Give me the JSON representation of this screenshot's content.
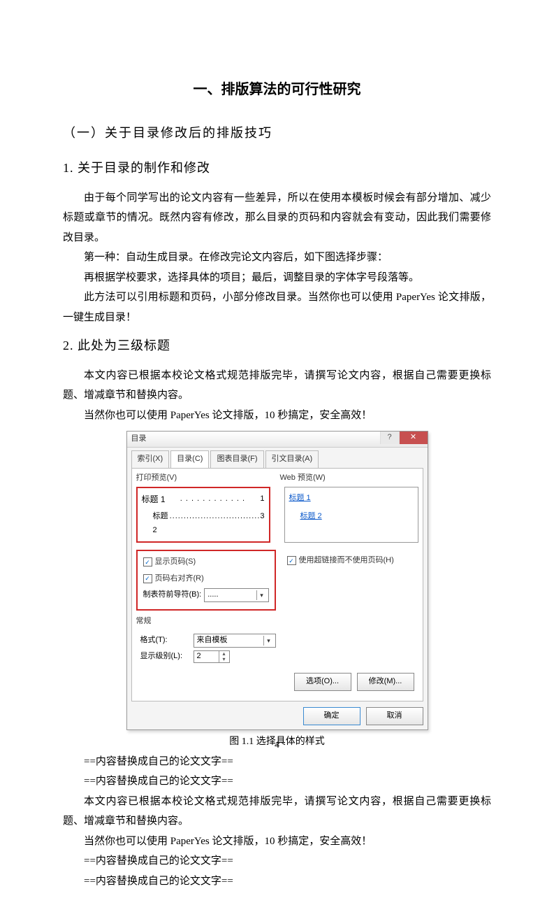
{
  "heading1": "一、排版算法的可行性研究",
  "heading2": "（一）关于目录修改后的排版技巧",
  "heading3_1": "1. 关于目录的制作和修改",
  "heading3_2": "2. 此处为三级标题",
  "p1": "由于每个同学写出的论文内容有一些差异，所以在使用本模板时候会有部分增加、减少标题或章节的情况。既然内容有修改，那么目录的页码和内容就会有变动，因此我们需要修改目录。",
  "p2": "第一种：自动生成目录。在修改完论文内容后，如下图选择步骤：",
  "p3": "再根据学校要求，选择具体的项目；最后，调整目录的字体字号段落等。",
  "p4": "此方法可以引用标题和页码，小部分修改目录。当然你也可以使用 PaperYes 论文排版，一键生成目录！",
  "p5": "本文内容已根据本校论文格式规范排版完毕，请撰写论文内容，根据自己需要更换标题、增减章节和替换内容。",
  "p6": "当然你也可以使用 PaperYes 论文排版，10 秒搞定，安全高效！",
  "caption": "图 1.1 选择具体的样式",
  "replace1": "==内容替换成自己的论文文字==",
  "replace2": "==内容替换成自己的论文文字==",
  "p7": "本文内容已根据本校论文格式规范排版完毕，请撰写论文内容，根据自己需要更换标题、增减章节和替换内容。",
  "p8": "当然你也可以使用 PaperYes 论文排版，10 秒搞定，安全高效！",
  "replace3": "==内容替换成自己的论文文字==",
  "replace4": "==内容替换成自己的论文文字==",
  "page_number": "4",
  "dialog": {
    "title": "目录",
    "tabs": [
      "索引(X)",
      "目录(C)",
      "图表目录(F)",
      "引文目录(A)"
    ],
    "print_preview_label": "打印预览(V)",
    "web_preview_label": "Web 预览(W)",
    "print_line1_a": "标题 1",
    "print_line1_b": "1",
    "print_line2_a": "标题 2",
    "print_line2_b": "3",
    "web_item1": "标题 1",
    "web_item2": "标题 2",
    "chk_show_pagenum": "显示页码(S)",
    "chk_right_align": "页码右对齐(R)",
    "chk_hyperlink": "使用超链接而不使用页码(H)",
    "tab_leader_label": "制表符前导符(B):",
    "tab_leader_value": ".....",
    "general_label": "常规",
    "format_label": "格式(T):",
    "format_value": "来自模板",
    "levels_label": "显示级别(L):",
    "levels_value": "2",
    "options_btn": "选项(O)...",
    "modify_btn": "修改(M)...",
    "ok_btn": "确定",
    "cancel_btn": "取消"
  }
}
